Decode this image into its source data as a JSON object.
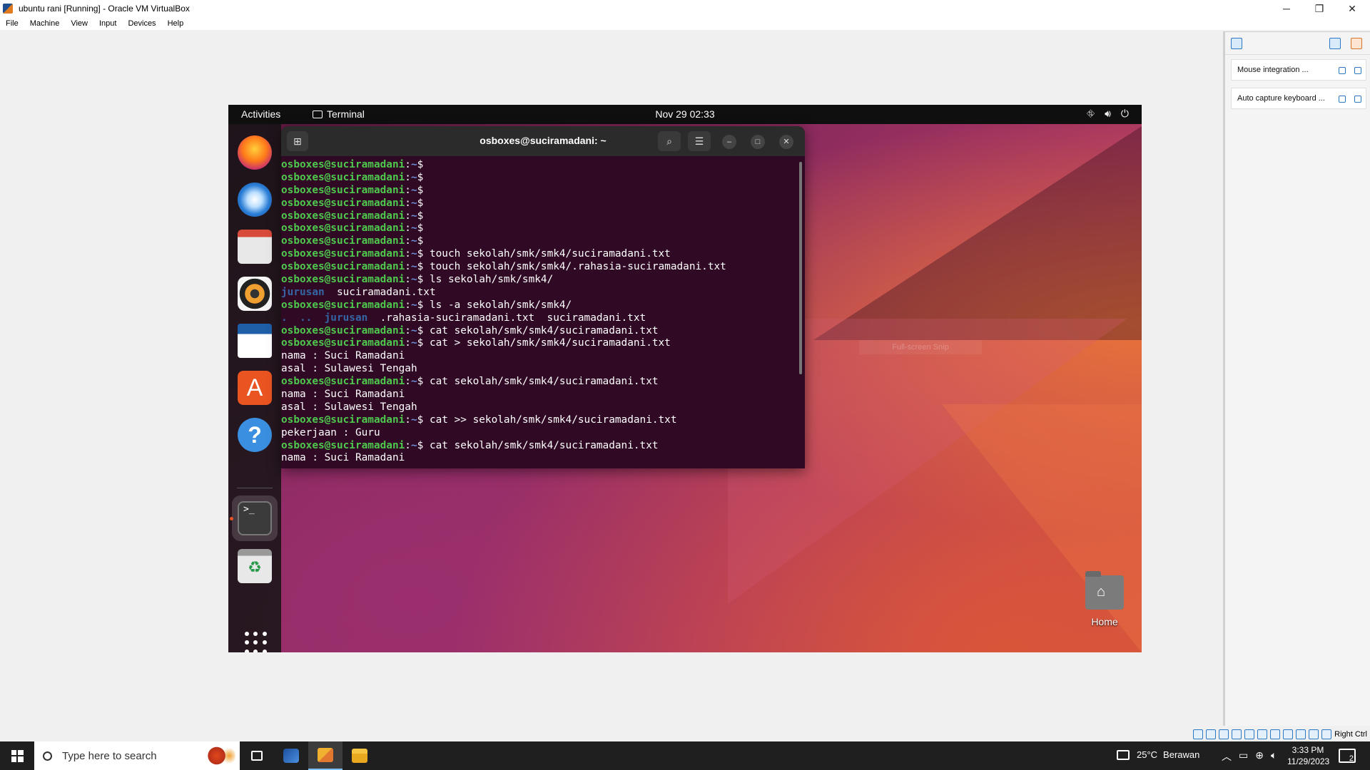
{
  "vbox": {
    "title": "ubuntu rani [Running] - Oracle VM VirtualBox",
    "menu": [
      "File",
      "Machine",
      "View",
      "Input",
      "Devices",
      "Help"
    ],
    "notices": [
      "Mouse integration ...",
      "Auto capture keyboard ..."
    ],
    "host_key": "Right Ctrl"
  },
  "ubuntu": {
    "activities": "Activities",
    "app_indicator": "Terminal",
    "clock": "Nov 29  02:33",
    "desktop_home_label": "Home",
    "dock_apps": [
      "firefox-icon",
      "thunderbird-icon",
      "files-icon",
      "rhythmbox-icon",
      "writer-icon",
      "app-center-icon",
      "help-icon",
      "terminal-icon",
      "trash-icon"
    ],
    "snip_hint": "Full-screen Snip"
  },
  "terminal": {
    "title": "osboxes@suciramadani: ~",
    "prompt_user": "osboxes@suciramadani",
    "prompt_path": "~",
    "lines": [
      {
        "type": "prompt",
        "cmd": ""
      },
      {
        "type": "prompt",
        "cmd": ""
      },
      {
        "type": "prompt",
        "cmd": ""
      },
      {
        "type": "prompt",
        "cmd": ""
      },
      {
        "type": "prompt",
        "cmd": ""
      },
      {
        "type": "prompt",
        "cmd": ""
      },
      {
        "type": "prompt",
        "cmd": ""
      },
      {
        "type": "prompt",
        "cmd": "touch sekolah/smk/smk4/suciramadani.txt"
      },
      {
        "type": "prompt",
        "cmd": "touch sekolah/smk/smk4/.rahasia-suciramadani.txt"
      },
      {
        "type": "prompt",
        "cmd": "ls sekolah/smk/smk4/"
      },
      {
        "type": "ls",
        "dirs": "jurusan",
        "rest": "  suciramadani.txt"
      },
      {
        "type": "prompt",
        "cmd": "ls -a sekolah/smk/smk4/"
      },
      {
        "type": "ls",
        "dirs": ".  ..  jurusan",
        "rest": "  .rahasia-suciramadani.txt  suciramadani.txt"
      },
      {
        "type": "prompt",
        "cmd": "cat sekolah/smk/smk4/suciramadani.txt"
      },
      {
        "type": "prompt",
        "cmd": "cat > sekolah/smk/smk4/suciramadani.txt"
      },
      {
        "type": "out",
        "text": "nama : Suci Ramadani"
      },
      {
        "type": "out",
        "text": "asal : Sulawesi Tengah"
      },
      {
        "type": "prompt",
        "cmd": "cat sekolah/smk/smk4/suciramadani.txt"
      },
      {
        "type": "out",
        "text": "nama : Suci Ramadani"
      },
      {
        "type": "out",
        "text": "asal : Sulawesi Tengah"
      },
      {
        "type": "prompt",
        "cmd": "cat >> sekolah/smk/smk4/suciramadani.txt"
      },
      {
        "type": "out",
        "text": "pekerjaan : Guru"
      },
      {
        "type": "prompt",
        "cmd": "cat sekolah/smk/smk4/suciramadani.txt"
      },
      {
        "type": "out",
        "text": "nama : Suci Ramadani"
      }
    ]
  },
  "taskbar": {
    "search_placeholder": "Type here to search",
    "temperature": "25°C",
    "weather": "Berawan",
    "time": "3:33 PM",
    "date": "11/29/2023",
    "notification_count": "2"
  },
  "colors": {
    "terminal_bg": "#300a24",
    "prompt_user": "#4ec94e",
    "prompt_path": "#6c8fd9",
    "ubuntu_accent": "#e95420"
  }
}
